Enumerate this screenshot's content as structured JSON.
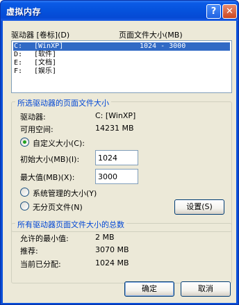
{
  "window": {
    "title": "虚拟内存",
    "help_glyph": "?",
    "close_glyph": "✕"
  },
  "drives_header": {
    "drive_label": "驱动器 [卷标](D)",
    "paging_label": "页面文件大小(MB)"
  },
  "drives": [
    {
      "letter": "C:",
      "label": "[WinXP]",
      "size": "1024 - 3000",
      "selected": true
    },
    {
      "letter": "D:",
      "label": "[软件]",
      "size": "",
      "selected": false
    },
    {
      "letter": "E:",
      "label": "[文档]",
      "size": "",
      "selected": false
    },
    {
      "letter": "F:",
      "label": "[娱乐]",
      "size": "",
      "selected": false
    }
  ],
  "selected_group": {
    "title": "所选驱动器的页面文件大小",
    "drive_label": "驱动器:",
    "drive_value": "C:  [WinXP]",
    "space_label": "可用空间:",
    "space_value": "14231 MB",
    "custom_label": "自定义大小(C):",
    "initial_label": "初始大小(MB)(I):",
    "initial_value": "1024",
    "max_label": "最大值(MB)(X):",
    "max_value": "3000",
    "system_label": "系统管理的大小(Y)",
    "nopaging_label": "无分页文件(N)",
    "set_button": "设置(S)",
    "selected_option": "custom"
  },
  "totals_group": {
    "title": "所有驱动器页面文件大小的总数",
    "min_label": "允许的最小值:",
    "min_value": "2 MB",
    "recommended_label": "推荐:",
    "recommended_value": "3070 MB",
    "allocated_label": "当前已分配:",
    "allocated_value": "1024 MB"
  },
  "buttons": {
    "ok": "确定",
    "cancel": "取消"
  }
}
